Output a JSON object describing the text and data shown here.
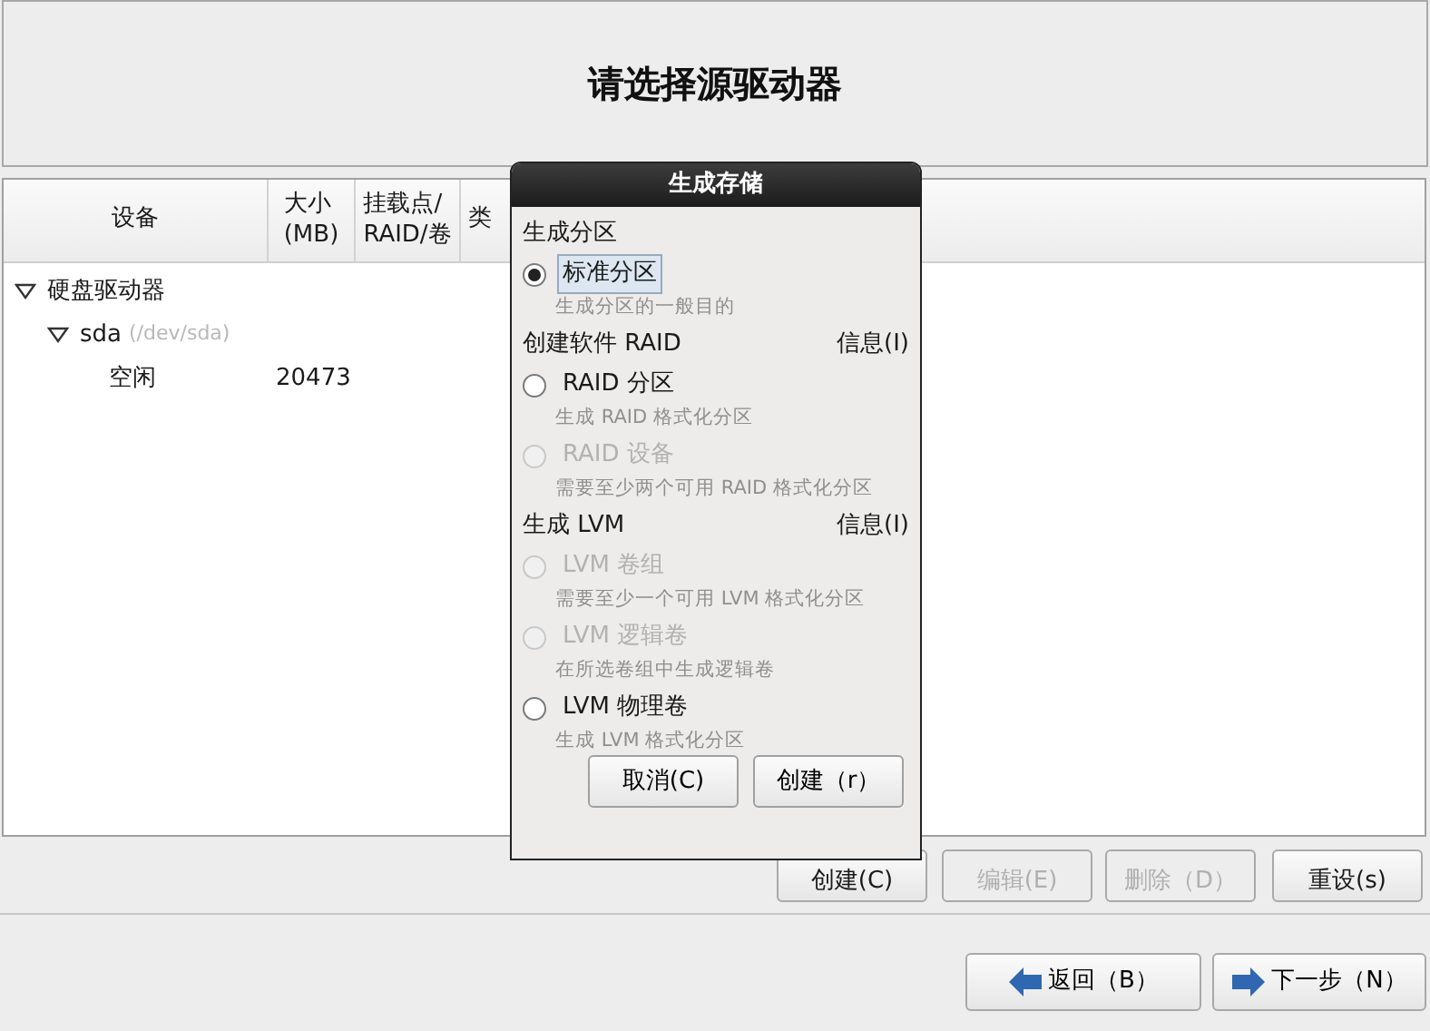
{
  "header": {
    "title": "请选择源驱动器"
  },
  "table": {
    "columns": [
      "设备",
      "大小\n(MB)",
      "挂载点/\nRAID/卷",
      "类"
    ],
    "tree": [
      {
        "label": "硬盘驱动器",
        "expanded": true,
        "children": [
          {
            "label": "sda",
            "path": "(/dev/sda)",
            "expanded": true,
            "children": [
              {
                "label": "空闲",
                "size": "20473"
              }
            ]
          }
        ]
      }
    ]
  },
  "actions": [
    {
      "label": "创建(C)",
      "disabled": false
    },
    {
      "label": "编辑(E)",
      "disabled": true
    },
    {
      "label": "删除（D）",
      "disabled": true
    },
    {
      "label": "重设(s)",
      "disabled": false
    }
  ],
  "navigation": [
    {
      "label": "返回（B）",
      "kind": "back"
    },
    {
      "label": "下一步（N）",
      "kind": "next"
    }
  ],
  "dialog": {
    "title": "生成存储",
    "sections": [
      {
        "heading": "生成分区",
        "options": [
          {
            "label": "标准分区",
            "description": "生成分区的一般目的",
            "selected": true,
            "disabled": false,
            "focused": true
          }
        ]
      },
      {
        "heading": "创建软件 RAID",
        "info": "信息(I)",
        "options": [
          {
            "label": "RAID 分区",
            "description": "生成 RAID 格式化分区",
            "selected": false,
            "disabled": false,
            "focused": false
          },
          {
            "label": "RAID 设备",
            "description": "需要至少两个可用 RAID 格式化分区",
            "selected": false,
            "disabled": true,
            "focused": false
          }
        ]
      },
      {
        "heading": "生成 LVM",
        "info": "信息(I)",
        "options": [
          {
            "label": "LVM 卷组",
            "description": "需要至少一个可用 LVM 格式化分区",
            "selected": false,
            "disabled": true,
            "focused": false
          },
          {
            "label": "LVM 逻辑卷",
            "description": "在所选卷组中生成逻辑卷",
            "selected": false,
            "disabled": true,
            "focused": false
          },
          {
            "label": "LVM 物理卷",
            "description": "生成 LVM 格式化分区",
            "selected": false,
            "disabled": false,
            "focused": false
          }
        ]
      }
    ],
    "buttons": [
      "取消(C)",
      "创建（r）"
    ]
  }
}
